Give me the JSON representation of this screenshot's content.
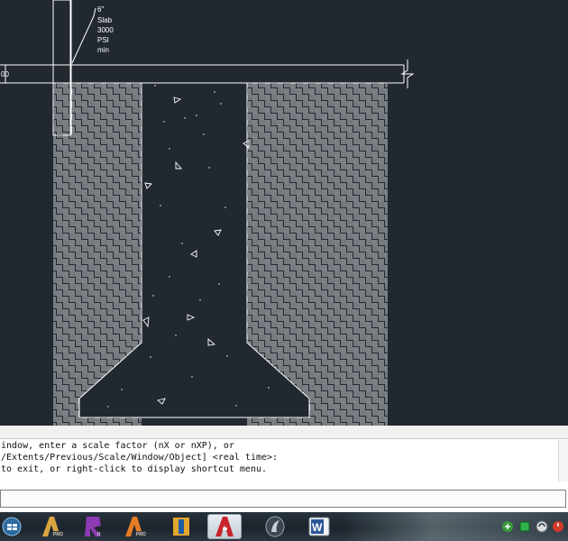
{
  "drawing": {
    "slab_note": [
      "6\"",
      "Slab",
      "3000",
      "PSI",
      "min"
    ],
    "dimension_fragment": "00"
  },
  "command_line": {
    "history": [
      "indow, enter a scale factor (nX or nXP), or",
      "/Extents/Previous/Scale/Window/Object] <real time>:",
      "to exit, or right-click to display shortcut menu."
    ],
    "input_value": ""
  },
  "taskbar": {
    "apps": [
      {
        "name": "start-orb",
        "badge": ""
      },
      {
        "name": "autocad-architecture-pro",
        "badge": "PRO"
      },
      {
        "name": "revit",
        "badge": "R"
      },
      {
        "name": "autocad-pro",
        "badge": "PRO"
      },
      {
        "name": "inventor",
        "badge": "I"
      },
      {
        "name": "autocad",
        "badge": ""
      },
      {
        "name": "media-player",
        "badge": ""
      },
      {
        "name": "word",
        "badge": "W"
      }
    ],
    "tray": [
      "network-icon",
      "green-status-icon",
      "sync-icon",
      "power-icon"
    ]
  },
  "colors": {
    "model_space": "#212830",
    "lines": "#ffffff",
    "taskbar": "#1c242c",
    "autocad_red": "#c8242b",
    "word_blue": "#2b579a"
  }
}
